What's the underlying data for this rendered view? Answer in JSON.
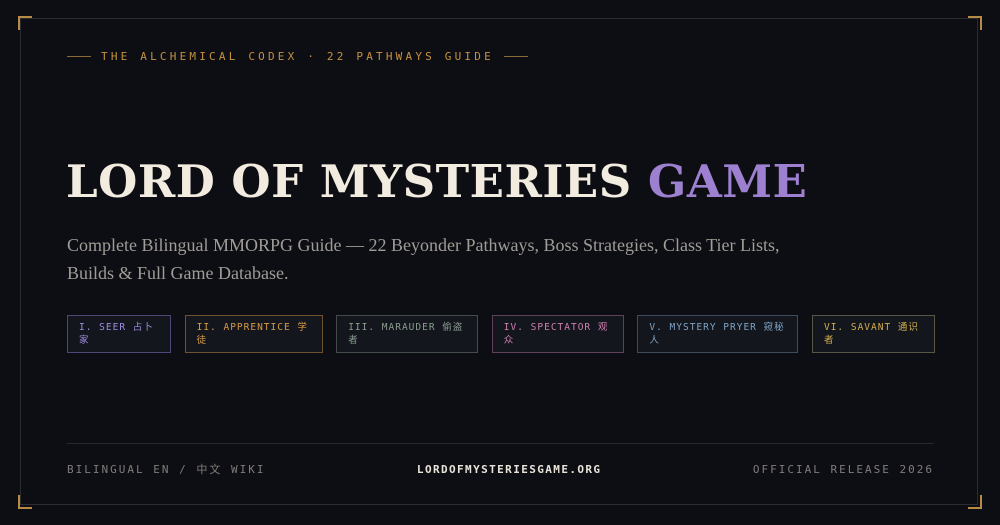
{
  "eyebrow": "THE ALCHEMICAL CODEX · 22 PATHWAYS GUIDE",
  "title": {
    "main": "LORD OF MYSTERIES",
    "accent": "GAME"
  },
  "subtitle": "Complete Bilingual MMORPG Guide — 22 Beyonder Pathways, Boss Strategies, Class Tier Lists, Builds & Full Game Database.",
  "pathways": [
    {
      "label": "I. SEER 占卜家",
      "color": "#9e8be0"
    },
    {
      "label": "II. APPRENTICE 学徒",
      "color": "#d69a45"
    },
    {
      "label": "III. MARAUDER 偷盗者",
      "color": "#8a9d8f"
    },
    {
      "label": "IV. SPECTATOR 观众",
      "color": "#cf7fb0"
    },
    {
      "label": "V. MYSTERY PRYER 窥秘人",
      "color": "#7fa3c6"
    },
    {
      "label": "VI. SAVANT 通识者",
      "color": "#d2ad4e"
    }
  ],
  "footer": {
    "left": "BILINGUAL EN / 中文 WIKI",
    "center": "LORDOFMYSTERIESGAME.ORG",
    "right": "OFFICIAL RELEASE 2026"
  },
  "colors": {
    "background": "#0d0e13",
    "gold": "#c6913f",
    "accent_purple": "#9d80cf",
    "title": "#f1ebe0"
  }
}
